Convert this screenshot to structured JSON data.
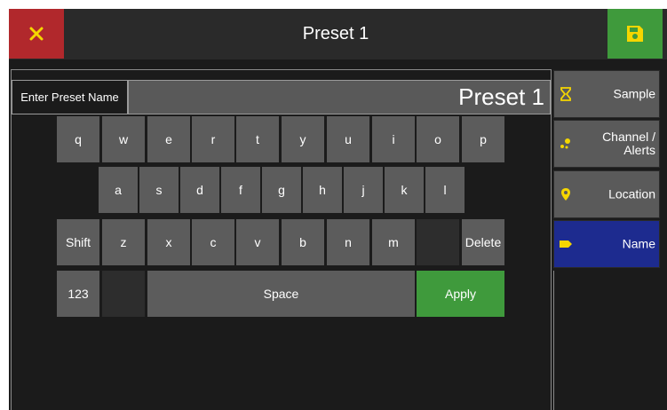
{
  "header": {
    "title": "Preset 1",
    "close_icon": "close-icon",
    "save_icon": "save-icon",
    "close_color": "#b1282c",
    "save_color": "#3f9a3c",
    "icon_color": "#f5d600"
  },
  "name_field": {
    "label": "Enter Preset Name",
    "value": "Preset 1"
  },
  "keyboard": {
    "row1": [
      "q",
      "w",
      "e",
      "r",
      "t",
      "y",
      "u",
      "i",
      "o",
      "p"
    ],
    "row2": [
      "a",
      "s",
      "d",
      "f",
      "g",
      "h",
      "j",
      "k",
      "l"
    ],
    "row3": [
      "Shift",
      "z",
      "x",
      "c",
      "v",
      "b",
      "n",
      "m",
      "",
      "Delete"
    ],
    "row4": {
      "numbers": "123",
      "space": "Space",
      "apply": "Apply"
    }
  },
  "nav": {
    "items": [
      {
        "label": "Sample",
        "icon": "hourglass-icon"
      },
      {
        "label": "Channel / Alerts",
        "icon": "channel-icon"
      },
      {
        "label": "Location",
        "icon": "location-pin-icon"
      },
      {
        "label": "Name",
        "icon": "tag-icon",
        "active": true
      }
    ]
  }
}
